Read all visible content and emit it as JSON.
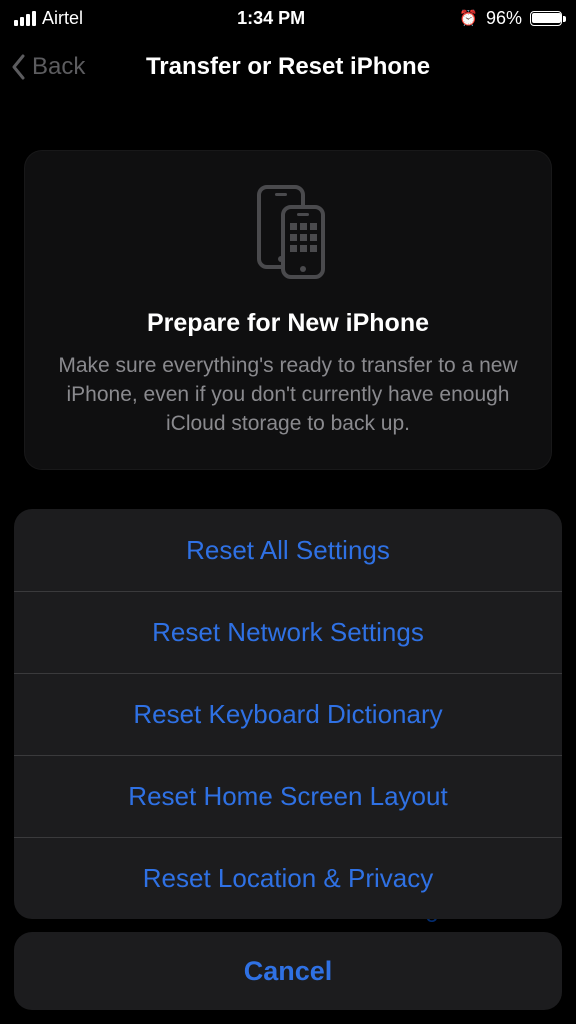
{
  "status": {
    "carrier": "Airtel",
    "time": "1:34 PM",
    "battery_pct": "96%"
  },
  "nav": {
    "back_label": "Back",
    "title": "Transfer or Reset iPhone"
  },
  "card": {
    "title": "Prepare for New iPhone",
    "description": "Make sure everything's ready to transfer to a new iPhone, even if you don't currently have enough iCloud storage to back up."
  },
  "hidden_row": "Erase All Content and Settings",
  "sheet": {
    "items": [
      "Reset All Settings",
      "Reset Network Settings",
      "Reset Keyboard Dictionary",
      "Reset Home Screen Layout",
      "Reset Location & Privacy"
    ],
    "cancel": "Cancel"
  },
  "colors": {
    "accent": "#2f71e4",
    "background": "#000000",
    "sheet_bg": "#1c1c1e",
    "divider": "#3a3a3c",
    "muted": "#8a8a8e"
  }
}
